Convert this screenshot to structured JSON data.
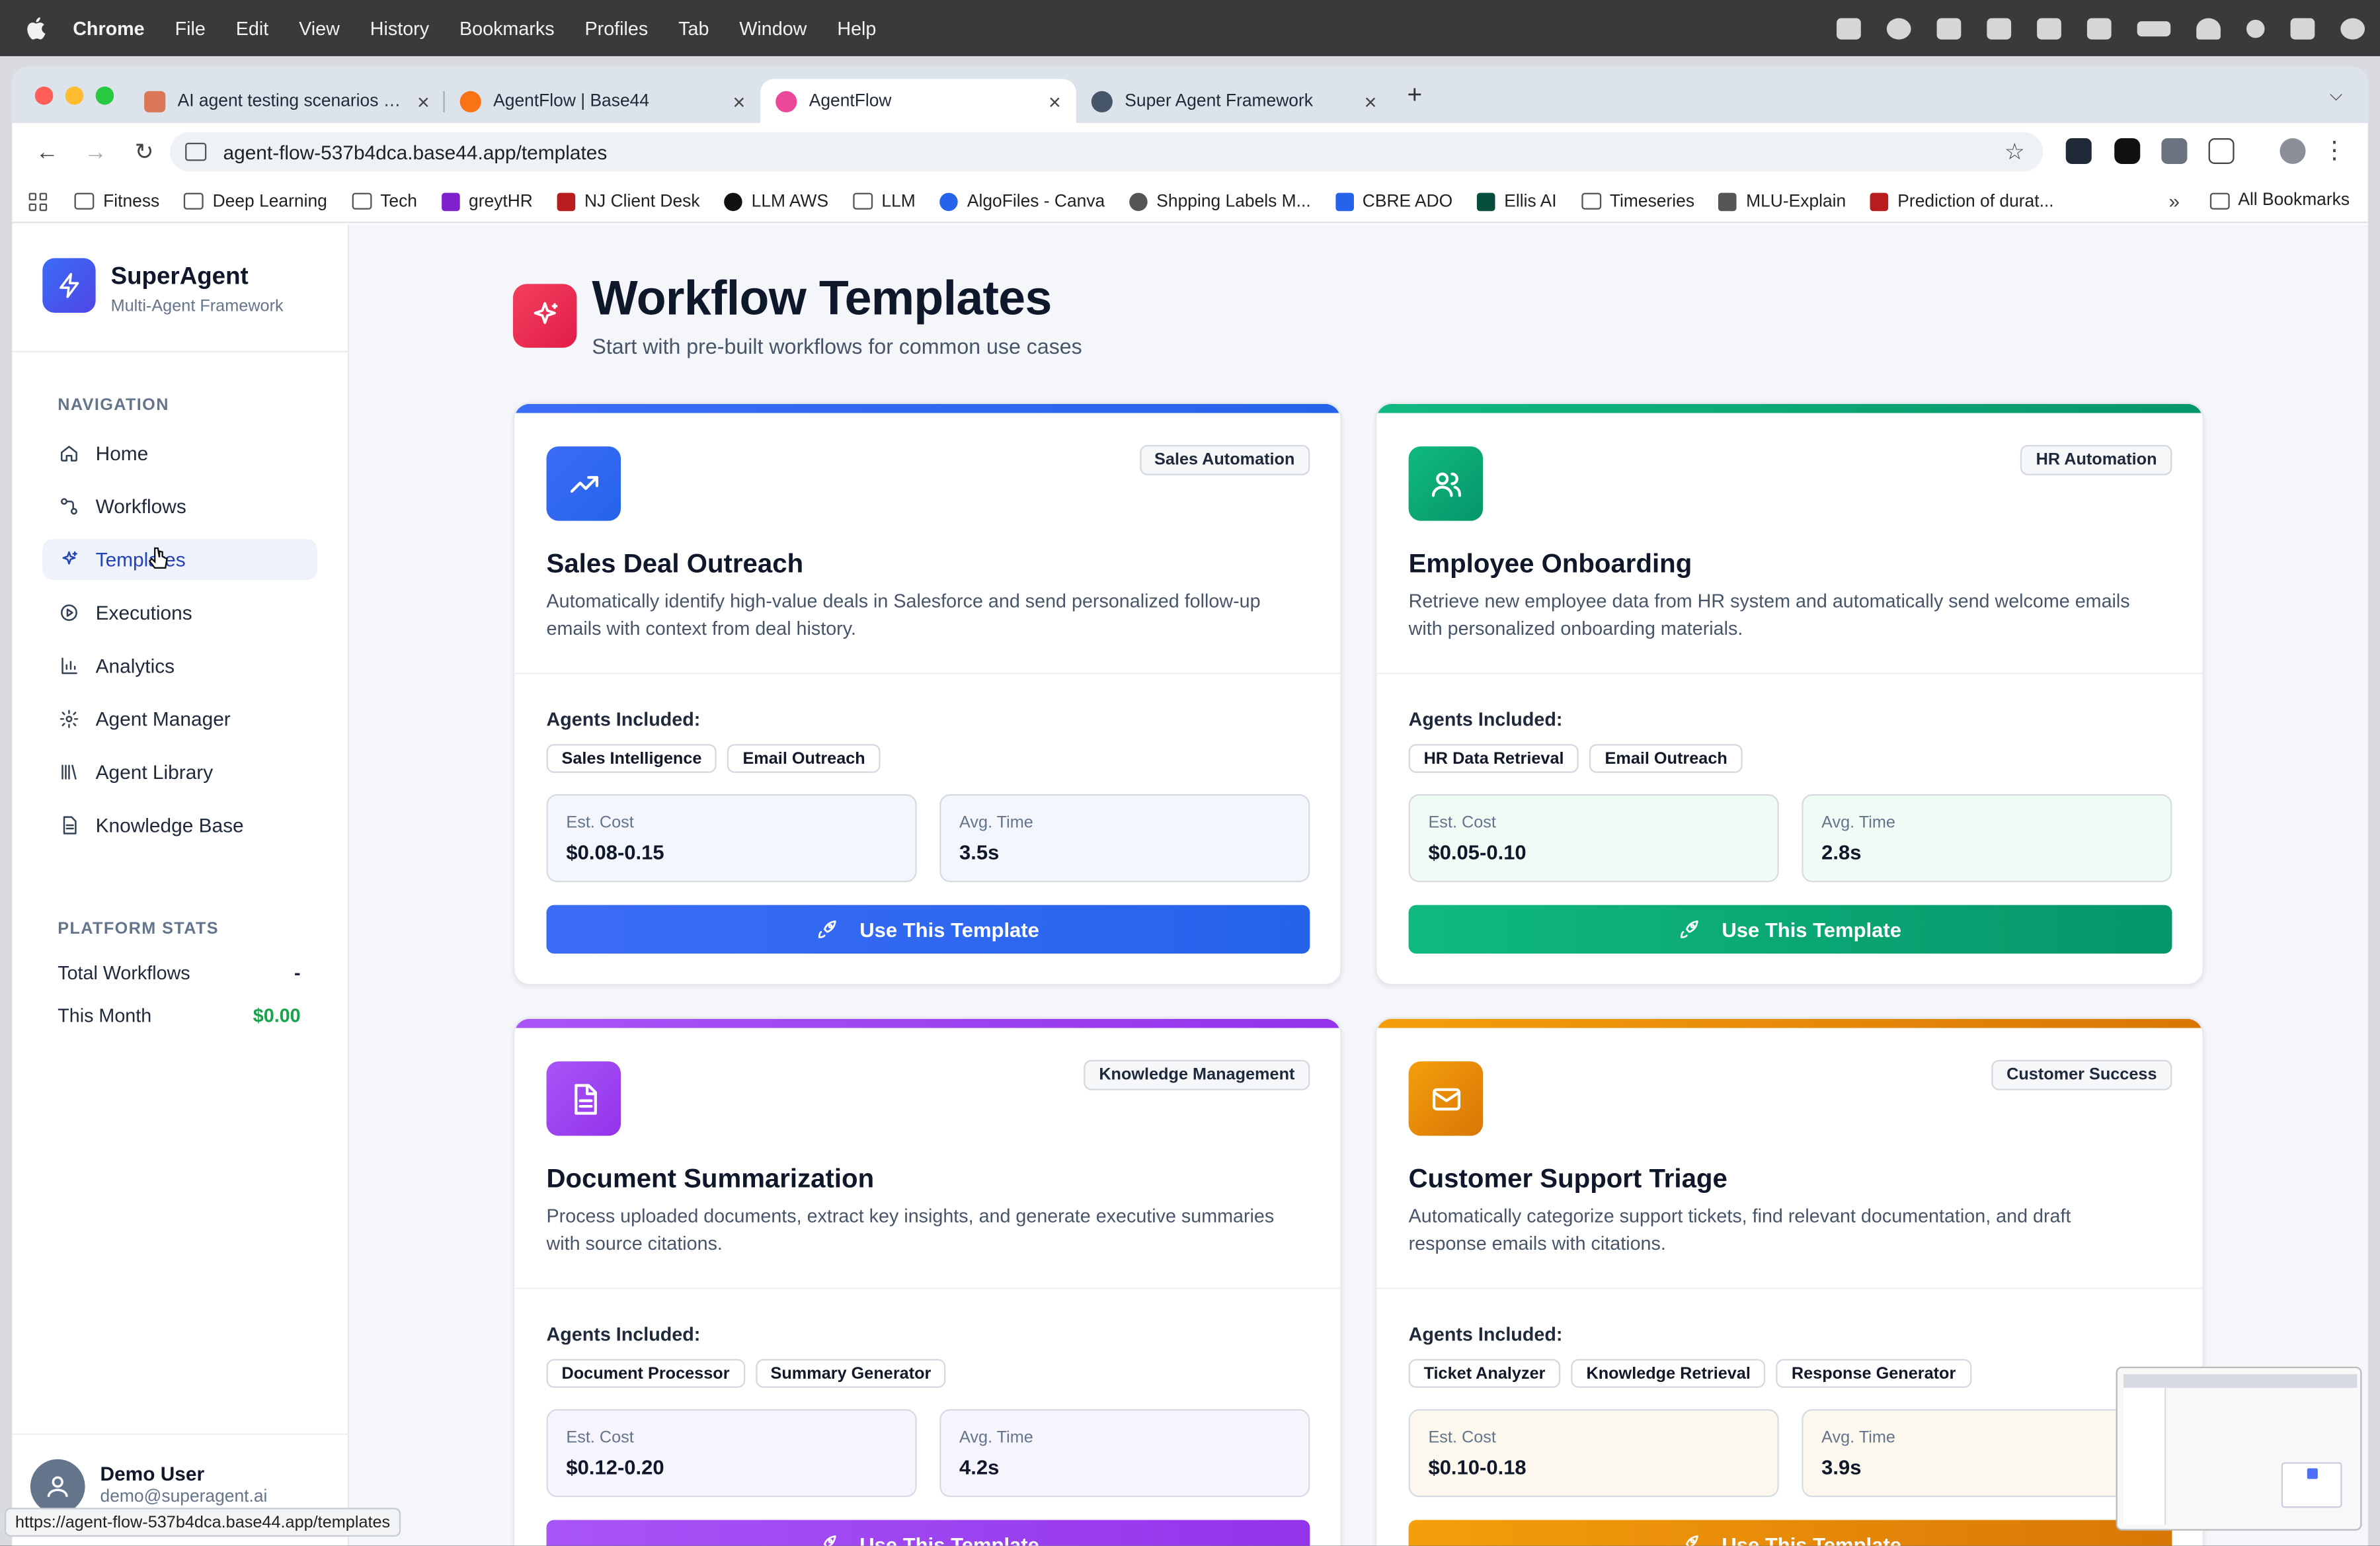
{
  "menubar": {
    "app": "Chrome",
    "items": [
      "File",
      "Edit",
      "View",
      "History",
      "Bookmarks",
      "Profiles",
      "Tab",
      "Window",
      "Help"
    ]
  },
  "tabs": [
    {
      "title": "AI agent testing scenarios - C",
      "favicon_color": "#d97757",
      "active": false
    },
    {
      "title": "AgentFlow | Base44",
      "favicon_color": "#f97316",
      "active": false
    },
    {
      "title": "AgentFlow",
      "favicon_color": "#ec4899",
      "active": true
    },
    {
      "title": "Super Agent Framework",
      "favicon_color": "#475569",
      "active": false
    }
  ],
  "address_bar": {
    "url": "agent-flow-537b4dca.base44.app/templates"
  },
  "bookmarks": [
    {
      "label": "Fitness",
      "icon": "folder-icon"
    },
    {
      "label": "Deep Learning",
      "icon": "folder-icon"
    },
    {
      "label": "Tech",
      "icon": "folder-icon"
    },
    {
      "label": "greytHR",
      "icon": "greythr-icon"
    },
    {
      "label": "NJ Client Desk",
      "icon": "nj-icon"
    },
    {
      "label": "LLM AWS",
      "icon": "github-icon"
    },
    {
      "label": "LLM",
      "icon": "folder-icon"
    },
    {
      "label": "AlgoFiles - Canva",
      "icon": "canva-icon"
    },
    {
      "label": "Shpping Labels M...",
      "icon": "globe-icon"
    },
    {
      "label": "CBRE ADO",
      "icon": "ado-icon"
    },
    {
      "label": "Ellis AI",
      "icon": "cbre-icon"
    },
    {
      "label": "Timeseries",
      "icon": "folder-icon"
    },
    {
      "label": "MLU-Explain",
      "icon": "mlu-icon"
    },
    {
      "label": "Prediction of durat...",
      "icon": "prediction-icon"
    }
  ],
  "bookmarks_all": "All Bookmarks",
  "sidebar": {
    "brand": "SuperAgent",
    "brand_sub": "Multi-Agent Framework",
    "nav_heading": "NAVIGATION",
    "nav": [
      {
        "label": "Home",
        "icon": "home-icon",
        "active": false
      },
      {
        "label": "Workflows",
        "icon": "workflow-icon",
        "active": false
      },
      {
        "label": "Templates",
        "icon": "sparkles-icon",
        "active": true
      },
      {
        "label": "Executions",
        "icon": "play-circle-icon",
        "active": false
      },
      {
        "label": "Analytics",
        "icon": "bar-chart-icon",
        "active": false
      },
      {
        "label": "Agent Manager",
        "icon": "gear-icon",
        "active": false
      },
      {
        "label": "Agent Library",
        "icon": "library-icon",
        "active": false
      },
      {
        "label": "Knowledge Base",
        "icon": "document-icon",
        "active": false
      }
    ],
    "stats_heading": "PLATFORM STATS",
    "stats": [
      {
        "label": "Total Workflows",
        "value": "-",
        "color": "#0f172a"
      },
      {
        "label": "This Month",
        "value": "$0.00",
        "color": "#16a34a"
      }
    ],
    "user": {
      "name": "Demo User",
      "email": "demo@superagent.ai"
    }
  },
  "page": {
    "title": "Workflow Templates",
    "subtitle": "Start with pre-built workflows for common use cases"
  },
  "templates": [
    {
      "title": "Sales Deal Outreach",
      "category": "Sales Automation",
      "description": "Automatically identify high-value deals in Salesforce and send personalized follow-up emails with context from deal history.",
      "agents_label": "Agents Included:",
      "agents": [
        "Sales Intelligence",
        "Email Outreach"
      ],
      "cost_label": "Est. Cost",
      "cost": "$0.08-0.15",
      "time_label": "Avg. Time",
      "time": "3.5s",
      "button": "Use This Template",
      "icon": "trending-up-icon",
      "accent": "#3b6cf6",
      "accent2": "#2563eb",
      "tint": "#f3f6fc"
    },
    {
      "title": "Employee Onboarding",
      "category": "HR Automation",
      "description": "Retrieve new employee data from HR system and automatically send welcome emails with personalized onboarding materials.",
      "agents_label": "Agents Included:",
      "agents": [
        "HR Data Retrieval",
        "Email Outreach"
      ],
      "cost_label": "Est. Cost",
      "cost": "$0.05-0.10",
      "time_label": "Avg. Time",
      "time": "2.8s",
      "button": "Use This Template",
      "icon": "users-icon",
      "accent": "#10b981",
      "accent2": "#059669",
      "tint": "#f1fbf6"
    },
    {
      "title": "Document Summarization",
      "category": "Knowledge Management",
      "description": "Process uploaded documents, extract key insights, and generate executive summaries with source citations.",
      "agents_label": "Agents Included:",
      "agents": [
        "Document Processor",
        "Summary Generator"
      ],
      "cost_label": "Est. Cost",
      "cost": "$0.12-0.20",
      "time_label": "Avg. Time",
      "time": "4.2s",
      "button": "Use This Template",
      "icon": "document-icon",
      "accent": "#a855f7",
      "accent2": "#9333ea",
      "tint": "#f6f4fc"
    },
    {
      "title": "Customer Support Triage",
      "category": "Customer Success",
      "description": "Automatically categorize support tickets, find relevant documentation, and draft response emails with citations.",
      "agents_label": "Agents Included:",
      "agents": [
        "Ticket Analyzer",
        "Knowledge Retrieval",
        "Response Generator"
      ],
      "cost_label": "Est. Cost",
      "cost": "$0.10-0.18",
      "time_label": "Avg. Time",
      "time": "3.9s",
      "button": "Use This Template",
      "icon": "mail-icon",
      "accent": "#f59e0b",
      "accent2": "#d97706",
      "tint": "#fdf8ee"
    }
  ],
  "status_url": "https://agent-flow-537b4dca.base44.app/templates"
}
